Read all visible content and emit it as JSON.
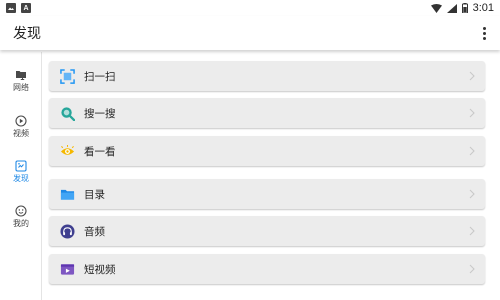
{
  "status_bar": {
    "time": "3:01",
    "notif_letter": "A"
  },
  "app_bar": {
    "title": "发现"
  },
  "nav": {
    "items": [
      {
        "label": "网络",
        "icon": "folder-network-icon"
      },
      {
        "label": "视频",
        "icon": "play-circle-icon"
      },
      {
        "label": "发现",
        "icon": "discover-icon",
        "active": true
      },
      {
        "label": "我的",
        "icon": "face-icon"
      }
    ]
  },
  "list": {
    "items": [
      {
        "label": "扫一扫",
        "icon": "scan-icon",
        "color": "#2196f3"
      },
      {
        "label": "搜一搜",
        "icon": "search-icon",
        "color": "#26a69a"
      },
      {
        "label": "看一看",
        "icon": "eye-icon",
        "color": "#f5b800"
      },
      {
        "label": "目录",
        "icon": "folder-icon",
        "color": "#1e88e5"
      },
      {
        "label": "音频",
        "icon": "headphones-icon",
        "color": "#3f3f8f"
      },
      {
        "label": "短视频",
        "icon": "video-icon",
        "color": "#7e57c2"
      }
    ]
  },
  "colors": {
    "accent": "#1e88e5",
    "row_bg": "#ececec"
  }
}
